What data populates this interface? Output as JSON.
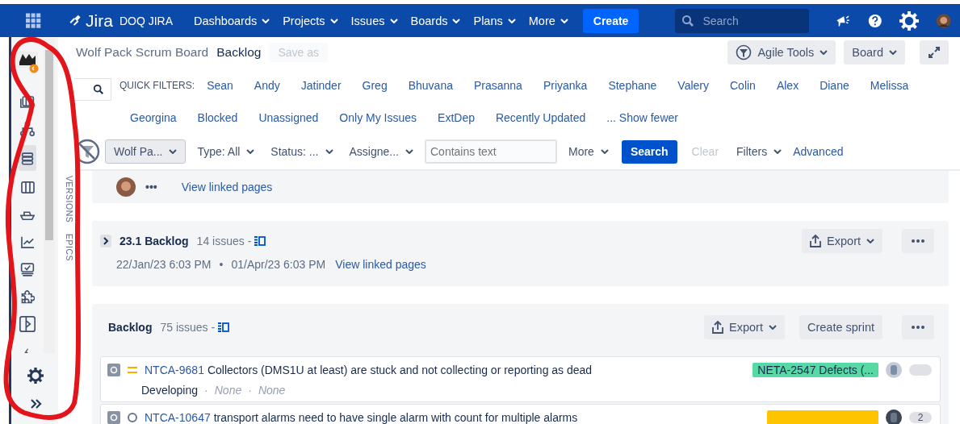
{
  "nav": {
    "product": "Jira",
    "site": "DOQ JIRA",
    "menus": [
      "Dashboards",
      "Projects",
      "Issues",
      "Boards",
      "Plans",
      "More"
    ],
    "create": "Create",
    "search_placeholder": "Search"
  },
  "sidebar": {
    "items": [
      {
        "kind": "project",
        "selected": false
      },
      {
        "kind": "stack",
        "selected": false
      },
      {
        "kind": "hierarchy",
        "selected": false
      },
      {
        "kind": "backlog",
        "selected": true
      },
      {
        "kind": "board",
        "selected": false
      },
      {
        "kind": "ship",
        "selected": false
      },
      {
        "kind": "chart",
        "selected": false
      },
      {
        "kind": "monitor",
        "selected": false
      },
      {
        "kind": "puzzle",
        "selected": false
      },
      {
        "kind": "panel",
        "selected": false
      },
      {
        "kind": "pen",
        "selected": false
      }
    ]
  },
  "side_tabs": [
    "VERSIONS",
    "EPICS"
  ],
  "header": {
    "board": "Wolf Pack Scrum Board",
    "view": "Backlog",
    "save_as": {
      "label": "Save as",
      "disabled": true
    },
    "tools": [
      "Agile Tools",
      "Board"
    ]
  },
  "quick_filters": {
    "label": "QUICK FILTERS:",
    "items": [
      "Sean",
      "Andy",
      "Jatinder",
      "Greg",
      "Bhuvana",
      "Prasanna",
      "Priyanka",
      "Stephane",
      "Valery",
      "Colin",
      "Alex",
      "Diane",
      "Melissa",
      "Georgina",
      "Blocked",
      "Unassigned",
      "Only My Issues",
      "ExtDep",
      "Recently Updated"
    ],
    "toggle": "... Show fewer"
  },
  "filter_bar": {
    "dropdowns": [
      "Wolf Pa...",
      "Type: All",
      "Status: ...",
      "Assigne..."
    ],
    "text_placeholder": "Contains text",
    "more": "More",
    "search": "Search",
    "clear": {
      "label": "Clear",
      "disabled": true
    },
    "filters": "Filters",
    "advanced": "Advanced"
  },
  "prev_sprint": {
    "menu": "•••",
    "link": "View linked pages"
  },
  "sprint": {
    "name": "23.1 Backlog",
    "count": "14 issues -",
    "dates": [
      "22/Jan/23 6:03 PM",
      "•",
      "01/Apr/23 6:03 PM"
    ],
    "link": "View linked pages",
    "export": "Export"
  },
  "backlog": {
    "name": "Backlog",
    "count": "75 issues -",
    "export": "Export",
    "create": "Create sprint",
    "issues": [
      {
        "key": "NTCA-9681",
        "summary": "Collectors (DMS1U at least) are stuck and not collecting or reporting as dead",
        "meta": [
          {
            "kind": "status",
            "text": "Developing"
          },
          {
            "kind": "sep",
            "text": "·"
          },
          {
            "kind": "field",
            "text": "None"
          },
          {
            "kind": "sep",
            "text": "·"
          },
          {
            "kind": "field",
            "text": "None"
          }
        ],
        "epic": "NETA-2547 Defects (...",
        "color": "#57d9a3"
      },
      {
        "key": "NTCA-10647",
        "summary": "transport alarms need to have single alarm with count for multiple alarms",
        "color": "#ffc400",
        "badge": "2"
      }
    ]
  }
}
